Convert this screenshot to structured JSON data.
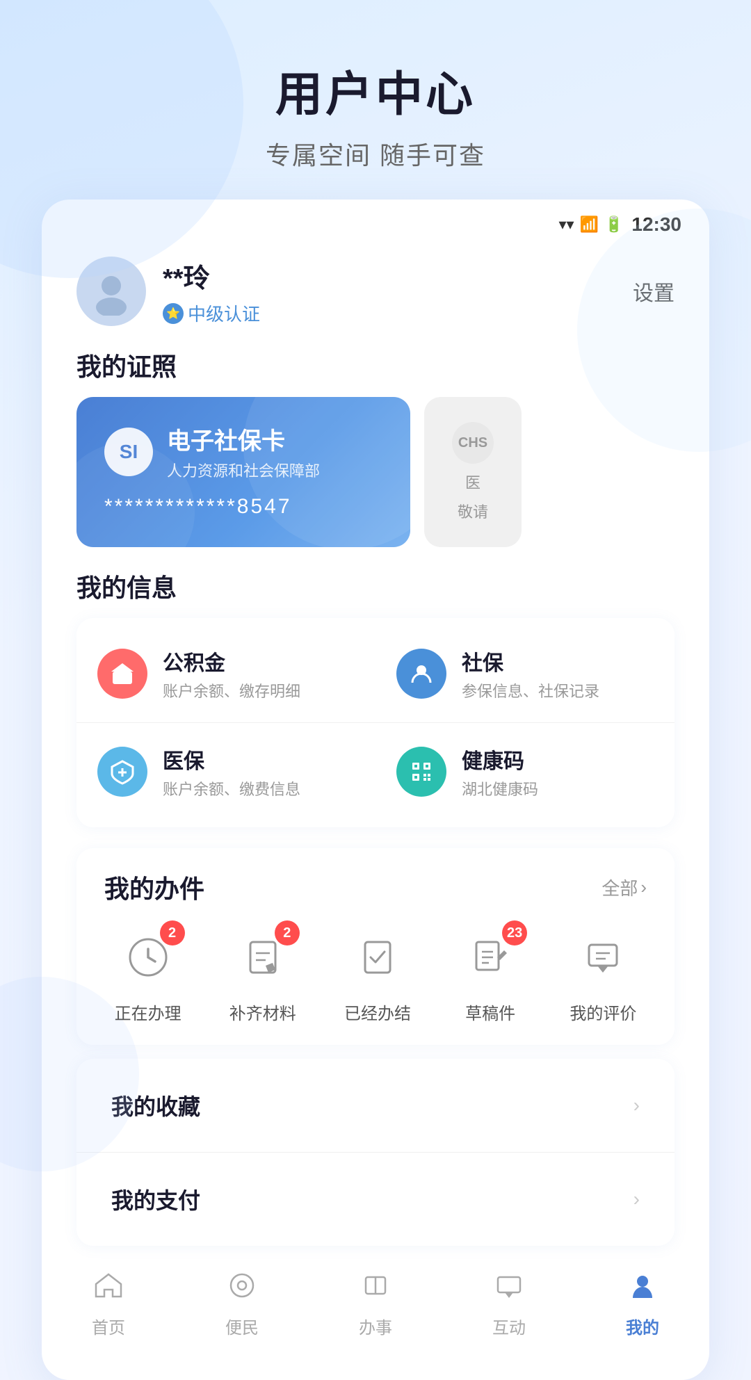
{
  "page": {
    "title": "用户中心",
    "subtitle": "专属空间 随手可查"
  },
  "statusBar": {
    "time": "12:30"
  },
  "user": {
    "name": "**玲",
    "certLevel": "中级认证",
    "settingsLabel": "设置"
  },
  "myCards": {
    "sectionTitle": "我的证照",
    "socialCard": {
      "logoText": "SI",
      "name": "电子社保卡",
      "org": "人力资源和社会保障部",
      "number": "*************8547"
    },
    "medicalCard": {
      "logoText": "CHS",
      "name": "医",
      "desc": "敬请"
    }
  },
  "myInfo": {
    "sectionTitle": "我的信息",
    "items": [
      {
        "name": "公积金",
        "desc": "账户余额、缴存明细",
        "iconColor": "icon-red"
      },
      {
        "name": "社保",
        "desc": "参保信息、社保记录",
        "iconColor": "icon-blue"
      },
      {
        "name": "医保",
        "desc": "账户余额、缴费信息",
        "iconColor": "icon-light-blue"
      },
      {
        "name": "健康码",
        "desc": "湖北健康码",
        "iconColor": "icon-teal"
      }
    ]
  },
  "myBusiness": {
    "sectionTitle": "我的办件",
    "viewAllLabel": "全部",
    "items": [
      {
        "label": "正在办理",
        "badge": "2",
        "hasBadge": true
      },
      {
        "label": "补齐材料",
        "badge": "2",
        "hasBadge": true
      },
      {
        "label": "已经办结",
        "badge": "",
        "hasBadge": false
      },
      {
        "label": "草稿件",
        "badge": "23",
        "hasBadge": true
      },
      {
        "label": "我的评价",
        "badge": "",
        "hasBadge": false
      }
    ]
  },
  "myFavorites": {
    "title": "我的收藏"
  },
  "myPayment": {
    "title": "我的支付"
  },
  "bottomNav": {
    "items": [
      {
        "label": "首页",
        "active": false
      },
      {
        "label": "便民",
        "active": false
      },
      {
        "label": "办事",
        "active": false
      },
      {
        "label": "互动",
        "active": false
      },
      {
        "label": "我的",
        "active": true
      }
    ]
  }
}
